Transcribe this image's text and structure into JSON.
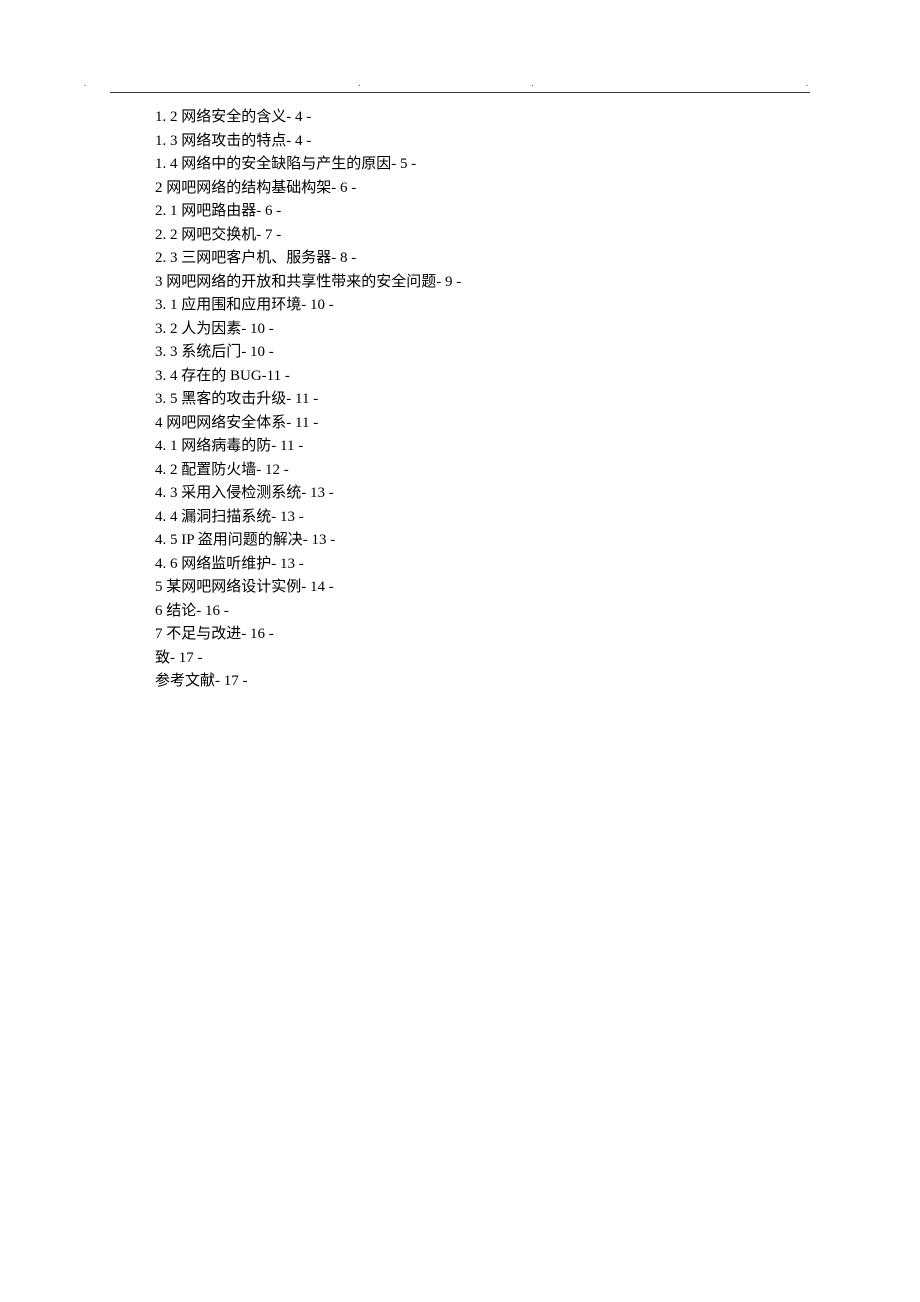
{
  "header": {
    "dots_left": ".        .",
    "dots_right": ".        ."
  },
  "toc": {
    "entries": [
      "1. 2 网络安全的含义- 4 -",
      "1. 3 网络攻击的特点- 4 -",
      "1. 4 网络中的安全缺陷与产生的原因- 5 -",
      "2 网吧网络的结构基础构架- 6 -",
      "2. 1 网吧路由器- 6 -",
      "2.  2 网吧交换机- 7 -",
      "2. 3 三网吧客户机、服务器- 8 -",
      "3 网吧网络的开放和共享性带来的安全问题- 9 -",
      "3. 1 应用围和应用环境- 10 -",
      "3. 2 人为因素- 10 -",
      "3. 3 系统后门- 10 -",
      "3. 4 存在的 BUG-11 -",
      "3. 5 黑客的攻击升级- 11 -",
      "4 网吧网络安全体系- 11 -",
      "4. 1 网络病毒的防- 11 -",
      "4. 2 配置防火墙- 12 -",
      "4. 3 采用入侵检测系统- 13 -",
      "4. 4 漏洞扫描系统- 13 -",
      "4. 5 IP 盗用问题的解决- 13 -",
      "4. 6 网络监听维护- 13 -",
      "5 某网吧网络设计实例- 14 -",
      "6 结论- 16 -",
      "7 不足与改进- 16 -",
      "致- 17 -",
      "参考文献- 17 -"
    ]
  }
}
